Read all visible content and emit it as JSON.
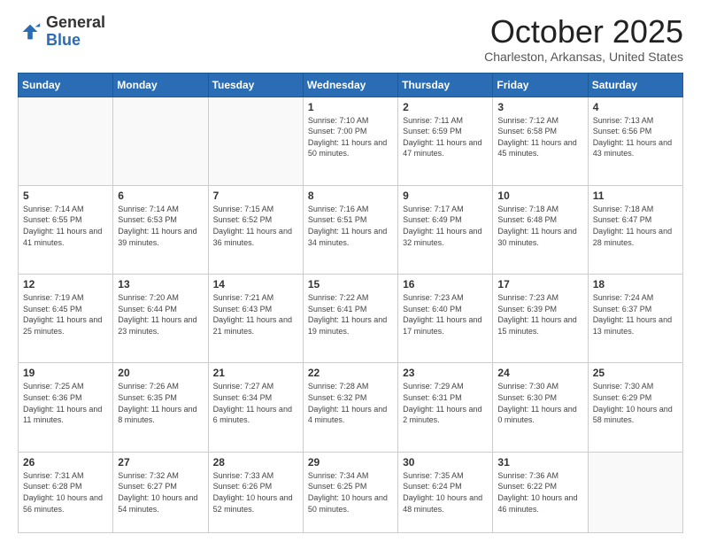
{
  "logo": {
    "general": "General",
    "blue": "Blue"
  },
  "header": {
    "month": "October 2025",
    "location": "Charleston, Arkansas, United States"
  },
  "days_of_week": [
    "Sunday",
    "Monday",
    "Tuesday",
    "Wednesday",
    "Thursday",
    "Friday",
    "Saturday"
  ],
  "weeks": [
    [
      {
        "day": "",
        "sunrise": "",
        "sunset": "",
        "daylight": ""
      },
      {
        "day": "",
        "sunrise": "",
        "sunset": "",
        "daylight": ""
      },
      {
        "day": "",
        "sunrise": "",
        "sunset": "",
        "daylight": ""
      },
      {
        "day": "1",
        "sunrise": "7:10 AM",
        "sunset": "7:00 PM",
        "daylight": "11 hours and 50 minutes."
      },
      {
        "day": "2",
        "sunrise": "7:11 AM",
        "sunset": "6:59 PM",
        "daylight": "11 hours and 47 minutes."
      },
      {
        "day": "3",
        "sunrise": "7:12 AM",
        "sunset": "6:58 PM",
        "daylight": "11 hours and 45 minutes."
      },
      {
        "day": "4",
        "sunrise": "7:13 AM",
        "sunset": "6:56 PM",
        "daylight": "11 hours and 43 minutes."
      }
    ],
    [
      {
        "day": "5",
        "sunrise": "7:14 AM",
        "sunset": "6:55 PM",
        "daylight": "11 hours and 41 minutes."
      },
      {
        "day": "6",
        "sunrise": "7:14 AM",
        "sunset": "6:53 PM",
        "daylight": "11 hours and 39 minutes."
      },
      {
        "day": "7",
        "sunrise": "7:15 AM",
        "sunset": "6:52 PM",
        "daylight": "11 hours and 36 minutes."
      },
      {
        "day": "8",
        "sunrise": "7:16 AM",
        "sunset": "6:51 PM",
        "daylight": "11 hours and 34 minutes."
      },
      {
        "day": "9",
        "sunrise": "7:17 AM",
        "sunset": "6:49 PM",
        "daylight": "11 hours and 32 minutes."
      },
      {
        "day": "10",
        "sunrise": "7:18 AM",
        "sunset": "6:48 PM",
        "daylight": "11 hours and 30 minutes."
      },
      {
        "day": "11",
        "sunrise": "7:18 AM",
        "sunset": "6:47 PM",
        "daylight": "11 hours and 28 minutes."
      }
    ],
    [
      {
        "day": "12",
        "sunrise": "7:19 AM",
        "sunset": "6:45 PM",
        "daylight": "11 hours and 25 minutes."
      },
      {
        "day": "13",
        "sunrise": "7:20 AM",
        "sunset": "6:44 PM",
        "daylight": "11 hours and 23 minutes."
      },
      {
        "day": "14",
        "sunrise": "7:21 AM",
        "sunset": "6:43 PM",
        "daylight": "11 hours and 21 minutes."
      },
      {
        "day": "15",
        "sunrise": "7:22 AM",
        "sunset": "6:41 PM",
        "daylight": "11 hours and 19 minutes."
      },
      {
        "day": "16",
        "sunrise": "7:23 AM",
        "sunset": "6:40 PM",
        "daylight": "11 hours and 17 minutes."
      },
      {
        "day": "17",
        "sunrise": "7:23 AM",
        "sunset": "6:39 PM",
        "daylight": "11 hours and 15 minutes."
      },
      {
        "day": "18",
        "sunrise": "7:24 AM",
        "sunset": "6:37 PM",
        "daylight": "11 hours and 13 minutes."
      }
    ],
    [
      {
        "day": "19",
        "sunrise": "7:25 AM",
        "sunset": "6:36 PM",
        "daylight": "11 hours and 11 minutes."
      },
      {
        "day": "20",
        "sunrise": "7:26 AM",
        "sunset": "6:35 PM",
        "daylight": "11 hours and 8 minutes."
      },
      {
        "day": "21",
        "sunrise": "7:27 AM",
        "sunset": "6:34 PM",
        "daylight": "11 hours and 6 minutes."
      },
      {
        "day": "22",
        "sunrise": "7:28 AM",
        "sunset": "6:32 PM",
        "daylight": "11 hours and 4 minutes."
      },
      {
        "day": "23",
        "sunrise": "7:29 AM",
        "sunset": "6:31 PM",
        "daylight": "11 hours and 2 minutes."
      },
      {
        "day": "24",
        "sunrise": "7:30 AM",
        "sunset": "6:30 PM",
        "daylight": "11 hours and 0 minutes."
      },
      {
        "day": "25",
        "sunrise": "7:30 AM",
        "sunset": "6:29 PM",
        "daylight": "10 hours and 58 minutes."
      }
    ],
    [
      {
        "day": "26",
        "sunrise": "7:31 AM",
        "sunset": "6:28 PM",
        "daylight": "10 hours and 56 minutes."
      },
      {
        "day": "27",
        "sunrise": "7:32 AM",
        "sunset": "6:27 PM",
        "daylight": "10 hours and 54 minutes."
      },
      {
        "day": "28",
        "sunrise": "7:33 AM",
        "sunset": "6:26 PM",
        "daylight": "10 hours and 52 minutes."
      },
      {
        "day": "29",
        "sunrise": "7:34 AM",
        "sunset": "6:25 PM",
        "daylight": "10 hours and 50 minutes."
      },
      {
        "day": "30",
        "sunrise": "7:35 AM",
        "sunset": "6:24 PM",
        "daylight": "10 hours and 48 minutes."
      },
      {
        "day": "31",
        "sunrise": "7:36 AM",
        "sunset": "6:22 PM",
        "daylight": "10 hours and 46 minutes."
      },
      {
        "day": "",
        "sunrise": "",
        "sunset": "",
        "daylight": ""
      }
    ]
  ],
  "labels": {
    "sunrise": "Sunrise:",
    "sunset": "Sunset:",
    "daylight": "Daylight:"
  }
}
